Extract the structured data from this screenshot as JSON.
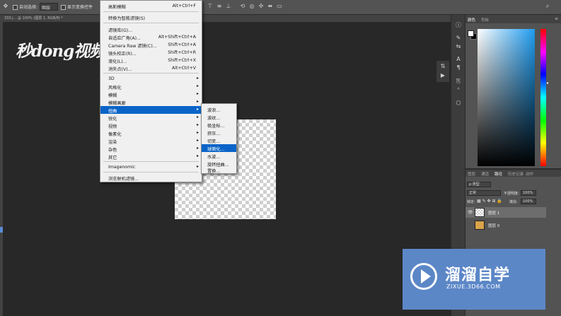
{
  "options_bar": {
    "auto_select_label": "自动选择:",
    "auto_select_value": "图层",
    "show_transform_label": "显示变换控件"
  },
  "document_tab": {
    "title": "333.j... @ 100% (图层 1, RGB/8) *"
  },
  "logo": {
    "text": "秒dong视频"
  },
  "filter_menu": {
    "items": [
      {
        "label": "高斯模糊",
        "shortcut": "Alt+Ctrl+F"
      },
      {
        "label": "转换为智能滤镜(S)",
        "shortcut": ""
      },
      {
        "label": "滤镜库(G)...",
        "shortcut": ""
      },
      {
        "label": "自适应广角(A)...",
        "shortcut": "Alt+Shift+Ctrl+A"
      },
      {
        "label": "Camera Raw 滤镜(C)...",
        "shortcut": "Shift+Ctrl+A"
      },
      {
        "label": "镜头校正(R)...",
        "shortcut": "Shift+Ctrl+R"
      },
      {
        "label": "液化(L)...",
        "shortcut": "Shift+Ctrl+X"
      },
      {
        "label": "消失点(V)...",
        "shortcut": "Alt+Ctrl+V"
      },
      {
        "label": "3D"
      },
      {
        "label": "风格化"
      },
      {
        "label": "模糊"
      },
      {
        "label": "模糊画廊"
      },
      {
        "label": "扭曲"
      },
      {
        "label": "锐化"
      },
      {
        "label": "视频"
      },
      {
        "label": "像素化"
      },
      {
        "label": "渲染"
      },
      {
        "label": "杂色"
      },
      {
        "label": "其它"
      },
      {
        "label": "Imagenomic"
      },
      {
        "label": "浏览联机滤镜..."
      }
    ]
  },
  "distort_submenu": {
    "items": [
      "波浪...",
      "波纹...",
      "极坐标...",
      "挤压...",
      "切变...",
      "球面化...",
      "水波...",
      "旋转扭曲...",
      "置换..."
    ]
  },
  "color_panel": {
    "tabs": [
      "颜色",
      "色板"
    ],
    "fg_color": "#ffffff",
    "bg_color": "#000000",
    "picker_hue": "#1f9cf0"
  },
  "layers_panel": {
    "tabs": [
      "图层",
      "通道",
      "路径",
      "历史记录",
      "动作"
    ],
    "kind_label": "ρ 类型",
    "blend_mode": "正常",
    "opacity_label": "不透明度:",
    "opacity_value": "100%",
    "lock_label": "锁定:",
    "fill_label": "填充:",
    "fill_value": "100%",
    "layers": [
      {
        "name": "图层 1",
        "selected": true
      },
      {
        "name": "图层 0",
        "selected": false
      }
    ]
  },
  "watermark": {
    "title": "溜溜自学",
    "subtitle": "ZIXUE.3D66.COM"
  }
}
